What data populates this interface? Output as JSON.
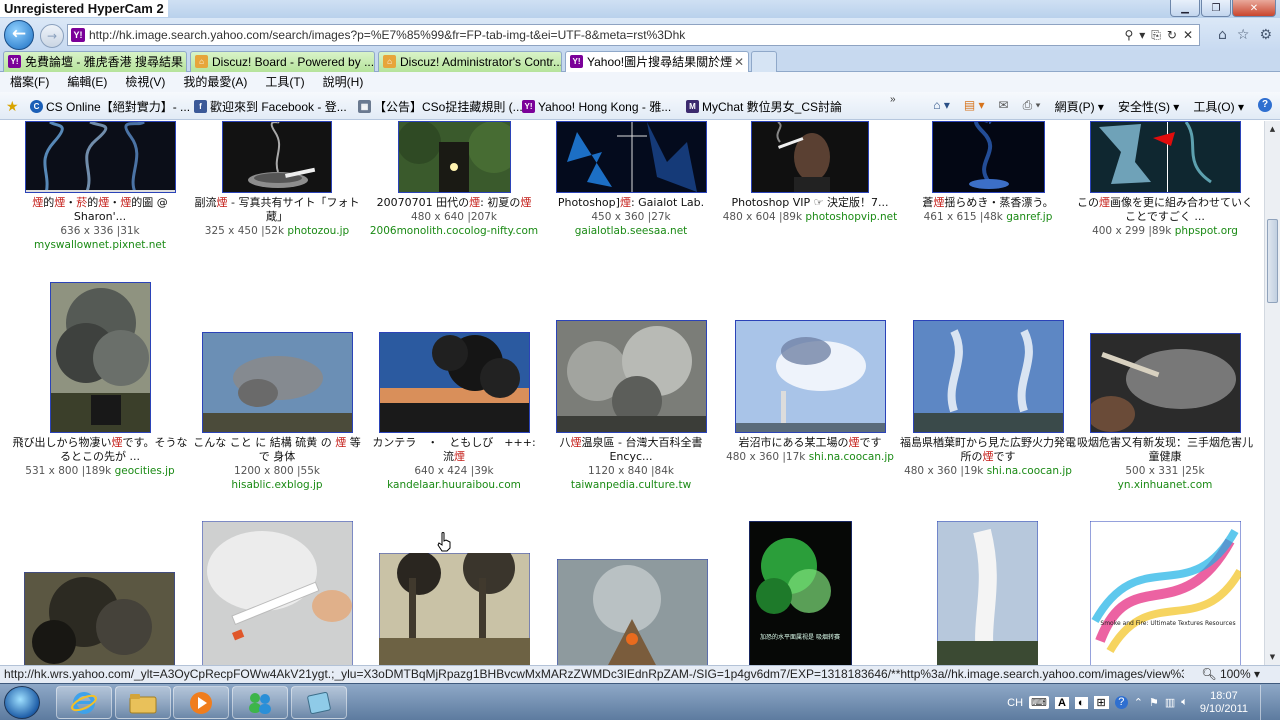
{
  "watermark": "Unregistered HyperCam 2",
  "address": {
    "url": "http://hk.image.search.yahoo.com/search/images?p=%E7%85%99&fr=FP-tab-img-t&ei=UTF-8&meta=rst%3Dhk"
  },
  "tabs": [
    {
      "label": "免費論壇 - 雅虎香港 搜尋結果",
      "icon": "Y!",
      "style": "green"
    },
    {
      "label": "Discuz! Board - Powered by ...",
      "icon": "⌂",
      "style": "green"
    },
    {
      "label": "Discuz! Administrator's Contr...",
      "icon": "⌂",
      "style": "green"
    },
    {
      "label": "Yahoo!圖片搜尋結果關於煙",
      "icon": "Y!",
      "style": "active"
    }
  ],
  "menu": [
    "檔案(F)",
    "編輯(E)",
    "檢視(V)",
    "我的最愛(A)",
    "工具(T)",
    "說明(H)"
  ],
  "favorites": [
    {
      "label": "CS Online【絕對實力】- ...",
      "icon": "C",
      "color": "#1b5fb7"
    },
    {
      "label": "歡迎來到 Facebook - 登...",
      "icon": "f",
      "color": "#3b5998"
    },
    {
      "label": "【公告】CSo捉挂藏規則 (...",
      "icon": "▦",
      "color": "#6b7a90"
    },
    {
      "label": "Yahoo! Hong Kong - 雅...",
      "icon": "Y!",
      "color": "#7b0099"
    },
    {
      "label": "MyChat 數位男女_CS討論",
      "icon": "M",
      "color": "#3c2a6e"
    }
  ],
  "commands": [
    "網頁(P) ▾",
    "安全性(S) ▾",
    "工具(O) ▾"
  ],
  "results": [
    {
      "title_html": "<span class=\"hl\">煙</span>的<span class=\"hl\">煙</span>・<span class=\"hl\">菸</span>的<span class=\"hl\">煙</span>・<span class=\"hl\">煙</span>的圖 @ Sharon'...",
      "meta": "636 x 336 |31k",
      "source": "myswallownet.pixnet.net"
    },
    {
      "title_html": "副流<span class=\"hl\">煙</span> - 写真共有サイト「フォト蔵」",
      "meta": "325 x 450 |52k",
      "source": "photozou.jp"
    },
    {
      "title_html": "20070701 田代の<span class=\"hl\">煙</span>: 初夏の<span class=\"hl\">煙</span>",
      "meta": "480 x 640 |207k",
      "source": "2006monolith.cocolog-nifty.com"
    },
    {
      "title_html": "Photoshop]<span class=\"hl\">煙</span>: Gaialot Lab.",
      "meta": "450 x 360 |27k",
      "source": "gaialotlab.seesaa.net"
    },
    {
      "title_html": "Photoshop VIP ☞ 決定版！7...",
      "meta": "480 x 604 |89k",
      "source": "photoshopvip.net"
    },
    {
      "title_html": "蒼<span class=\"hl\">煙</span>揺らめき・蒸香漂う。",
      "meta": "461 x 615 |48k",
      "source": "ganref.jp"
    },
    {
      "title_html": "この<span class=\"hl\">煙</span>画像を更に組み合わせていくことですごく ...",
      "meta": "400 x 299 |89k",
      "source": "phpspot.org"
    },
    {
      "title_html": "飛び出しから物凄い<span class=\"hl\">煙</span>です。そうなるとこの先が ...",
      "meta": "531 x 800 |189k",
      "source": "geocities.jp"
    },
    {
      "title_html": "こんな こと に 結構 硫黄 の <span class=\"hl\">煙</span> 等 で 身体",
      "meta": "1200 x 800 |55k",
      "source": "hisablic.exblog.jp"
    },
    {
      "title_html": "カンテラ　・　ともしび　+++: 流<span class=\"hl\">煙</span>",
      "meta": "640 x 424 |39k",
      "source": "kandelaar.huuraibou.com"
    },
    {
      "title_html": "八<span class=\"hl\">煙</span>温泉區 - 台灣大百科全書 Encyc...",
      "meta": "1120 x 840 |84k",
      "source": "taiwanpedia.culture.tw"
    },
    {
      "title_html": "岩沼市にある某工場の<span class=\"hl\">煙</span>です",
      "meta": "480 x 360 |17k",
      "source": "shi.na.coocan.jp"
    },
    {
      "title_html": "福島県楢葉町から見た広野火力発電所の<span class=\"hl\">煙</span>です",
      "meta": "480 x 360 |19k",
      "source": "shi.na.coocan.jp"
    },
    {
      "title_html": "吸烟危害又有新发现：三手烟危害儿童健康",
      "meta": "500 x 331 |25k",
      "source": "yn.xinhuanet.com"
    }
  ],
  "row3_thumbs": [
    {
      "desc": "smoke-over-hill"
    },
    {
      "desc": "hand-holding-cigarette"
    },
    {
      "desc": "factory-chimneys"
    },
    {
      "desc": "volcano-crowd"
    },
    {
      "desc": "green-smoke-poster",
      "text": "加恐的水平面属视是 吸烟转赛"
    },
    {
      "desc": "smoke-column-crowd"
    },
    {
      "desc": "colorful-smoke-poster",
      "text": "Smoke and Fire: Ultimate Textures Resources"
    }
  ],
  "status": {
    "url": "http://hk.wrs.yahoo.com/_ylt=A3OyCpRecpFOWw4AkV21ygt.;_ylu=X3oDMTBqMjRpazg1BHBvcwMxMARzZWMDc3IEdnRpZAM-/SIG=1p4gv6dm7/EXP=1318183646/**http%3a//hk.image.search.yahoo.com/images/view%3",
    "zoom": "100%"
  },
  "tray": {
    "lang": "CH",
    "time": "18:07",
    "date": "9/10/2011"
  }
}
